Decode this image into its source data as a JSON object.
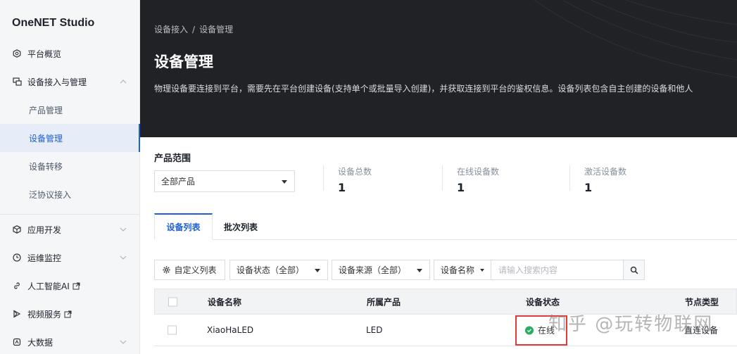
{
  "brand": "OneNET Studio",
  "sidebar": {
    "items": [
      {
        "label": "平台概览",
        "icon": "hexagon-icon"
      },
      {
        "label": "设备接入与管理",
        "icon": "device-icon"
      },
      {
        "label": "应用开发",
        "icon": "cube-icon"
      },
      {
        "label": "运维监控",
        "icon": "clock-icon"
      },
      {
        "label": "人工智能AI",
        "icon": "link-icon"
      },
      {
        "label": "视频服务",
        "icon": "play-icon"
      },
      {
        "label": "大数据",
        "icon": "database-icon"
      }
    ],
    "sub_items": [
      {
        "label": "产品管理"
      },
      {
        "label": "设备管理"
      },
      {
        "label": "设备转移"
      },
      {
        "label": "泛协议接入"
      }
    ]
  },
  "header": {
    "breadcrumb": [
      "设备接入",
      "设备管理"
    ],
    "breadcrumb_sep": "/",
    "title": "设备管理",
    "description": "物理设备要连接到平台，需要先在平台创建设备(支持单个或批量导入创建)，并获取连接到平台的鉴权信息。设备列表包含自主创建的设备和他人"
  },
  "product_range": {
    "label": "产品范围",
    "selected": "全部产品"
  },
  "stats": [
    {
      "label": "设备总数",
      "value": "1"
    },
    {
      "label": "在线设备数",
      "value": "1"
    },
    {
      "label": "激活设备数",
      "value": "1"
    }
  ],
  "tabs": [
    {
      "label": "设备列表",
      "active": true
    },
    {
      "label": "批次列表",
      "active": false
    }
  ],
  "toolbar": {
    "custom_columns": "自定义列表",
    "status_filter": "设备状态（全部）",
    "source_filter": "设备来源（全部）",
    "field_select": "设备名称",
    "search_placeholder": "请输入搜索内容"
  },
  "table": {
    "columns": [
      "设备名称",
      "所属产品",
      "设备状态",
      "节点类型"
    ],
    "rows": [
      {
        "name": "XiaoHaLED",
        "product": "LED",
        "status": "在线",
        "node_type": "直连设备"
      }
    ]
  },
  "watermark": "知乎 @玩转物联网",
  "colors": {
    "accent": "#1f5fd8",
    "header_bg": "#202226",
    "online": "#27ae60",
    "highlight": "#e03b3b"
  }
}
